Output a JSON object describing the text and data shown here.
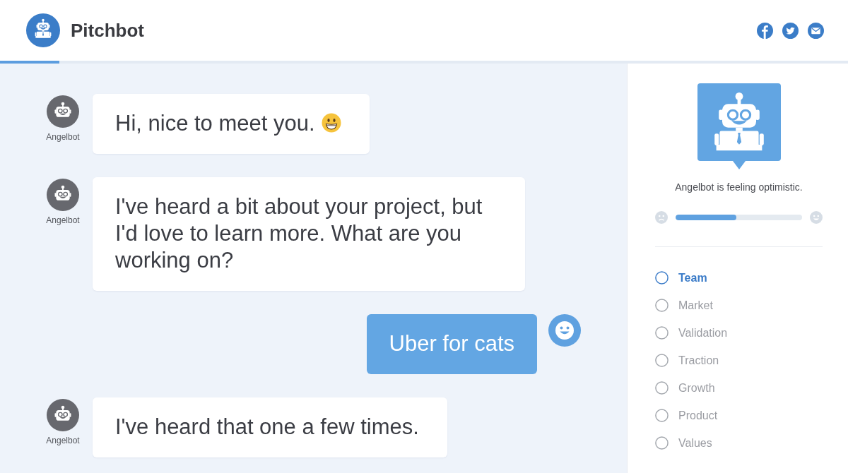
{
  "header": {
    "title": "Pitchbot",
    "progress": {
      "level": 0.07
    }
  },
  "messages": [
    {
      "kind": "bot",
      "name": "Angelbot",
      "text": "Hi, nice to meet you.",
      "emoji": true
    },
    {
      "kind": "bot",
      "name": "Angelbot",
      "text": "I've heard a bit about your project, but I'd love to learn more. What are you working on?",
      "emoji": false
    },
    {
      "kind": "user",
      "text": "Uber for cats",
      "emoji": false
    },
    {
      "kind": "bot",
      "name": "Angelbot",
      "text": "I've heard that one a few times.",
      "emoji": false
    }
  ],
  "sidebar": {
    "mood": {
      "caption": "Angelbot is feeling optimistic.",
      "level": 0.48
    },
    "topics": [
      {
        "label": "Team",
        "selected": true
      },
      {
        "label": "Market",
        "selected": false
      },
      {
        "label": "Validation",
        "selected": false
      },
      {
        "label": "Traction",
        "selected": false
      },
      {
        "label": "Growth",
        "selected": false
      },
      {
        "label": "Product",
        "selected": false
      },
      {
        "label": "Values",
        "selected": false
      }
    ]
  }
}
